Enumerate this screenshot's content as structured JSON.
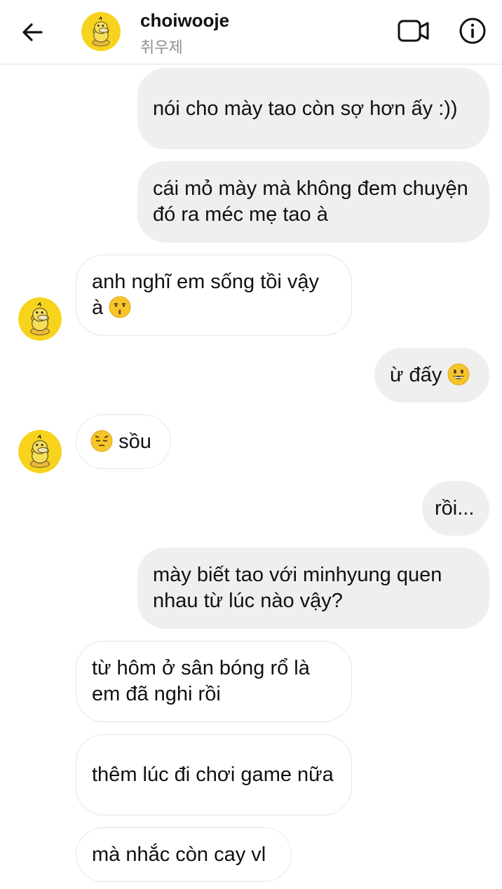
{
  "header": {
    "username": "choiwooje",
    "subtitle": "취우제",
    "avatar_icon": "psyduck-avatar-icon",
    "back_icon": "arrow-left-icon",
    "video_icon": "video-call-icon",
    "info_icon": "info-icon"
  },
  "colors": {
    "outgoing_bubble": "#efefef",
    "incoming_border": "#e6e6e6",
    "avatar_yellow": "#f7d31e"
  },
  "messages": [
    {
      "side": "outgoing",
      "text": "nói cho mày tao còn sợ hơn ấy :))"
    },
    {
      "side": "outgoing",
      "text": "cái mỏ mày mà không đem chuyện đó ra méc mẹ tao à"
    },
    {
      "side": "incoming",
      "text": "anh nghĩ em sống tồi vậy à",
      "emoji": "kissing-face-icon"
    },
    {
      "side": "outgoing",
      "text": "ừ đấy",
      "emoji": "smiling-face-icon"
    },
    {
      "side": "incoming",
      "text": "sồu",
      "emoji": "pensive-face-icon"
    },
    {
      "side": "outgoing",
      "text": "rồi..."
    },
    {
      "side": "outgoing",
      "text": "mày biết tao với minhyung quen nhau từ lúc nào vậy?"
    },
    {
      "side": "incoming",
      "text": "từ hôm ở sân bóng rổ là em đã nghi rồi"
    },
    {
      "side": "incoming",
      "text": "thêm lúc đi chơi game nữa"
    },
    {
      "side": "incoming",
      "text": "mà nhắc còn cay vl"
    }
  ]
}
